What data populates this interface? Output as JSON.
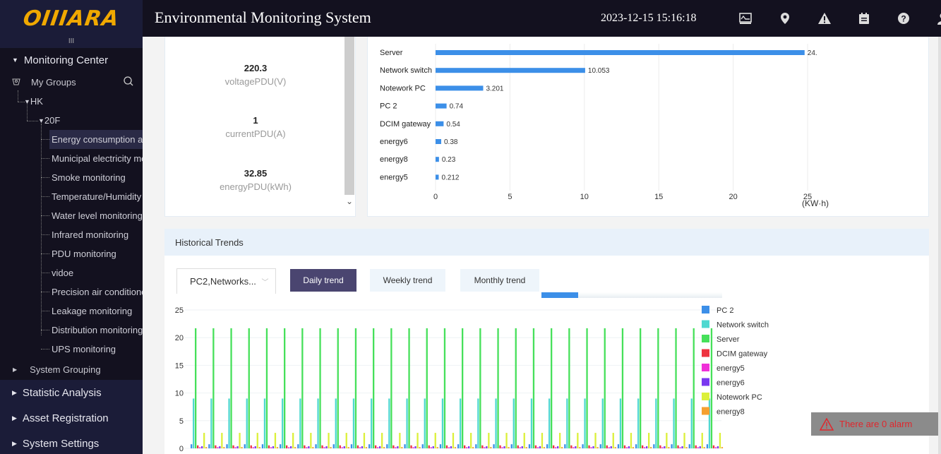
{
  "header": {
    "logo": "OIIIARA",
    "title": "Environmental Monitoring System",
    "datetime": "2023-12-15 15:16:18",
    "icons": [
      "trend-chart-icon",
      "location-pin-icon",
      "warning-icon",
      "calendar-icon",
      "help-icon",
      "user-icon"
    ]
  },
  "sidebar": {
    "collapse_label": "III",
    "monitoring_center": "Monitoring Center",
    "my_groups": "My Groups",
    "tree": {
      "root": "HK",
      "floor": "20F",
      "leaves": [
        "Energy consumption analysis",
        "Municipal electricity monitoring",
        "Smoke monitoring",
        "Temperature/Humidity monitoring",
        "Water level monitoring",
        "Infrared monitoring",
        "PDU monitoring",
        "vidoe",
        "Precision air conditioner",
        "Leakage monitoring",
        "Distribution monitoring",
        "UPS monitoring"
      ],
      "active_index": 0
    },
    "system_grouping": "System Grouping",
    "menus": [
      "Statistic Analysis",
      "Asset Registration",
      "System Settings"
    ]
  },
  "pdu_metrics": [
    {
      "value": "220.3",
      "label": "voltagePDU(V)"
    },
    {
      "value": "1",
      "label": "currentPDU(A)"
    },
    {
      "value": "32.85",
      "label": "energyPDU(kWh)"
    }
  ],
  "historical": {
    "title": "Historical Trends",
    "device_select": "PC2,Networks...",
    "buttons": [
      "Daily trend",
      "Weekly trend",
      "Monthly trend"
    ],
    "active_button": 0,
    "zoom_range": [
      0,
      0.2
    ]
  },
  "alarm": {
    "text": "There are 0 alarm",
    "color": "#e0272d"
  },
  "chart_data": [
    {
      "type": "bar",
      "orientation": "horizontal",
      "title": "",
      "categories": [
        "Server",
        "Network switch",
        "Notework PC",
        "PC 2",
        "DCIM gateway",
        "energy6",
        "energy8",
        "energy5"
      ],
      "values": [
        24.8,
        10.053,
        3.201,
        0.74,
        0.54,
        0.38,
        0.23,
        0.212
      ],
      "data_labels": [
        "24.",
        "10.053",
        "3.201",
        "0.74",
        "0.54",
        "0.38",
        "0.23",
        "0.212"
      ],
      "xlabel": "(KW·h)",
      "xlim": [
        0,
        25
      ],
      "xticks": [
        "0",
        "5",
        "10",
        "15",
        "20",
        "25"
      ],
      "grid": true,
      "color": "#3c8fe8"
    },
    {
      "type": "bar",
      "title": "",
      "ylim": [
        0,
        25
      ],
      "yticks": [
        "0",
        "5",
        "10",
        "15",
        "20",
        "25"
      ],
      "grid": true,
      "legend": "right",
      "group_count": 30,
      "series": [
        {
          "name": "PC 2",
          "color": "#3c8fe8",
          "value": 0.74
        },
        {
          "name": "Network switch",
          "color": "#4fd8d0",
          "value": 9.0
        },
        {
          "name": "Server",
          "color": "#46e05a",
          "value": 21.7
        },
        {
          "name": "DCIM gateway",
          "color": "#ee3340",
          "value": 0.54
        },
        {
          "name": "energy5",
          "color": "#f030d8",
          "value": 0.21
        },
        {
          "name": "energy6",
          "color": "#7a38f0",
          "value": 0.38
        },
        {
          "name": "Notework PC",
          "color": "#dcf03a",
          "value": 2.8
        },
        {
          "name": "energy8",
          "color": "#f5a030",
          "value": 0.23
        }
      ]
    }
  ]
}
